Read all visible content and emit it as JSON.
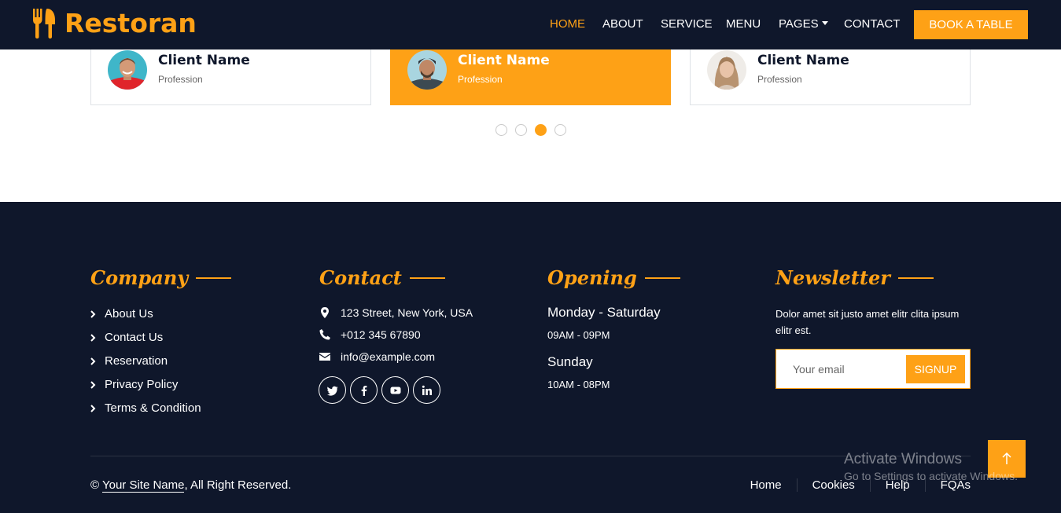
{
  "brand": {
    "name": "Restoran",
    "icon": "utensils-icon"
  },
  "nav": {
    "items": [
      {
        "label": "HOME",
        "active": true
      },
      {
        "label": "ABOUT"
      },
      {
        "label": "SERVICE"
      },
      {
        "label": "MENU"
      },
      {
        "label": "PAGES"
      },
      {
        "label": "CONTACT"
      }
    ],
    "book_label": "BOOK A TABLE"
  },
  "testimonials": [
    {
      "name": "Client Name",
      "profession": "Profession"
    },
    {
      "name": "Client Name",
      "profession": "Profession",
      "active": true
    },
    {
      "name": "Client Name",
      "profession": "Profession"
    }
  ],
  "carousel": {
    "pages": 4,
    "current": 3
  },
  "footer": {
    "company": {
      "title": "Company",
      "links": [
        "About Us",
        "Contact Us",
        "Reservation",
        "Privacy Policy",
        "Terms & Condition"
      ]
    },
    "contact": {
      "title": "Contact",
      "address": "123 Street, New York, USA",
      "phone": "+012 345 67890",
      "email": "info@example.com",
      "socials": [
        "twitter-icon",
        "facebook-icon",
        "youtube-icon",
        "linkedin-icon"
      ]
    },
    "opening": {
      "title": "Opening",
      "schedule": [
        {
          "days": "Monday - Saturday",
          "hours": "09AM - 09PM"
        },
        {
          "days": "Sunday",
          "hours": "10AM - 08PM"
        }
      ]
    },
    "newsletter": {
      "title": "Newsletter",
      "text": "Dolor amet sit justo amet elitr clita ipsum elitr est.",
      "placeholder": "Your email",
      "button": "SIGNUP"
    },
    "copyright": {
      "prefix": "©",
      "site": "Your Site Name",
      "suffix": ", All Right Reserved."
    },
    "bottom_links": [
      "Home",
      "Cookies",
      "Help",
      "FQAs"
    ]
  },
  "windows_watermark": {
    "line1": "Activate Windows",
    "line2": "Go to Settings to activate Windows."
  },
  "colors": {
    "accent": "#fea116",
    "dark": "#0f172b"
  }
}
